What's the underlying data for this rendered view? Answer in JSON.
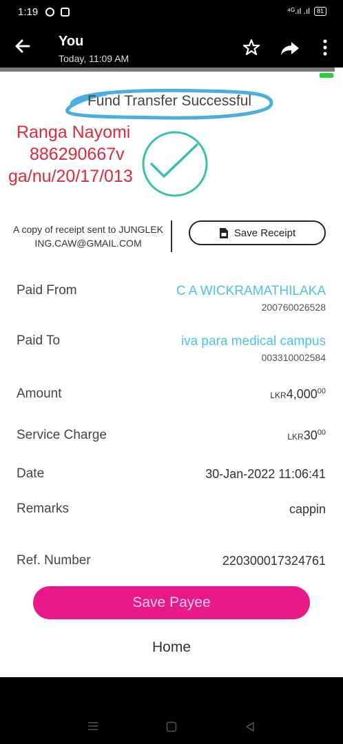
{
  "status_bar": {
    "time": "1:19",
    "signal": "⁴ᴳ.ıl .ıl",
    "battery": "81"
  },
  "header": {
    "title": "You",
    "subtitle": "Today, 11:09 AM"
  },
  "receipt": {
    "status": "Fund Transfer Successful",
    "handwritten": {
      "name": "Ranga Nayomi",
      "id": "886290667v",
      "reg": "ga/nu/20/17/013"
    },
    "copy_note": "A copy of receipt sent to JUNGLEKING.CAW@GMAIL.COM",
    "save_receipt_label": "Save Receipt",
    "fields": {
      "paid_from": {
        "label": "Paid From",
        "name": "C A WICKRAMATHILAKA",
        "account": "200760026528"
      },
      "paid_to": {
        "label": "Paid To",
        "name": "iva para medical campus",
        "account": "003310002584"
      },
      "amount": {
        "label": "Amount",
        "currency": "LKR",
        "whole": "4,000",
        "cents": "00"
      },
      "service_charge": {
        "label": "Service Charge",
        "currency": "LKR",
        "whole": "30",
        "cents": "00"
      },
      "date": {
        "label": "Date",
        "value": "30-Jan-2022 11:06:41"
      },
      "remarks": {
        "label": "Remarks",
        "value": "cappin"
      },
      "ref_number": {
        "label": "Ref. Number",
        "value": "220300017324761"
      }
    },
    "save_payee_label": "Save Payee",
    "home_label": "Home"
  },
  "colors": {
    "accent_pink": "#e8198b",
    "link_blue": "#4fc1e9",
    "handwriting_red": "#dc2b3c",
    "check_teal": "#3bbfad",
    "highlight_blue": "#4aaee0"
  }
}
